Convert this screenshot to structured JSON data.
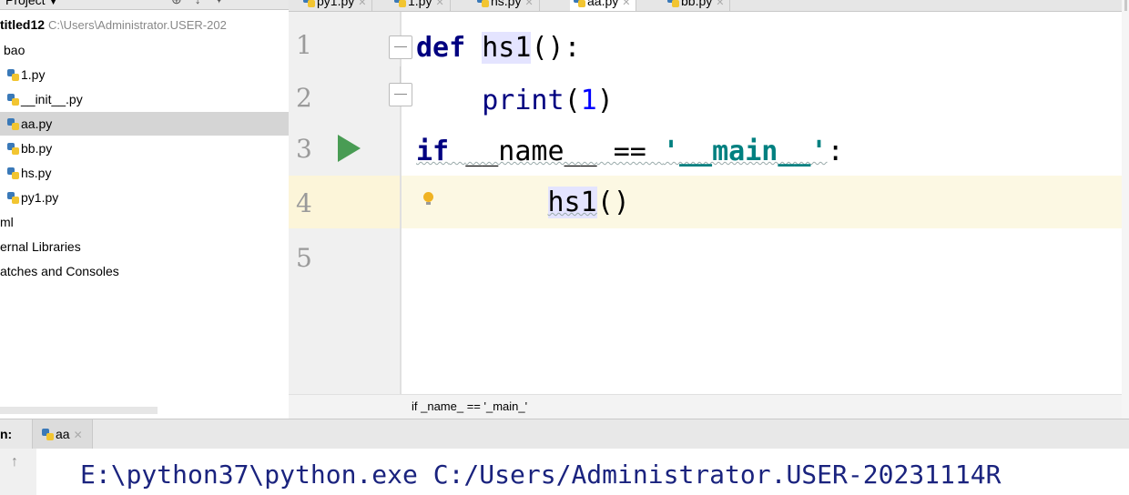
{
  "project": {
    "title": "Project",
    "root_name": "titled12",
    "root_path": "C:\\Users\\Administrator.USER-202",
    "tree": [
      {
        "label": "bao"
      },
      {
        "label": "1.py"
      },
      {
        "label": "__init__.py"
      },
      {
        "label": "aa.py"
      },
      {
        "label": "bb.py"
      },
      {
        "label": "hs.py"
      },
      {
        "label": "py1.py"
      },
      {
        "label": "ml"
      },
      {
        "label": "ernal Libraries"
      },
      {
        "label": "atches and Consoles"
      }
    ]
  },
  "tabs": [
    {
      "label": "py1.py"
    },
    {
      "label": "1.py"
    },
    {
      "label": "hs.py"
    },
    {
      "label": "aa.py"
    },
    {
      "label": "bb.py"
    }
  ],
  "editor": {
    "line_numbers": [
      "1",
      "2",
      "3",
      "4",
      "5"
    ],
    "code": {
      "l1_kw": "def",
      "l1_fn": "hs1",
      "l1_rest": "():",
      "l2_builtin": "print",
      "l2_open": "(",
      "l2_num": "1",
      "l2_close": ")",
      "l3_kw": "if",
      "l3_name": "__name__",
      "l3_op": " == ",
      "l3_str": "'__main__'",
      "l3_colon": ":",
      "l4_fn": "hs1",
      "l4_rest": "()"
    },
    "breadcrumb": "if _name_ == '_main_'"
  },
  "run": {
    "label": "n:",
    "tab": "aa",
    "output": "E:\\python37\\python.exe C:/Users/Administrator.USER-20231114R"
  }
}
